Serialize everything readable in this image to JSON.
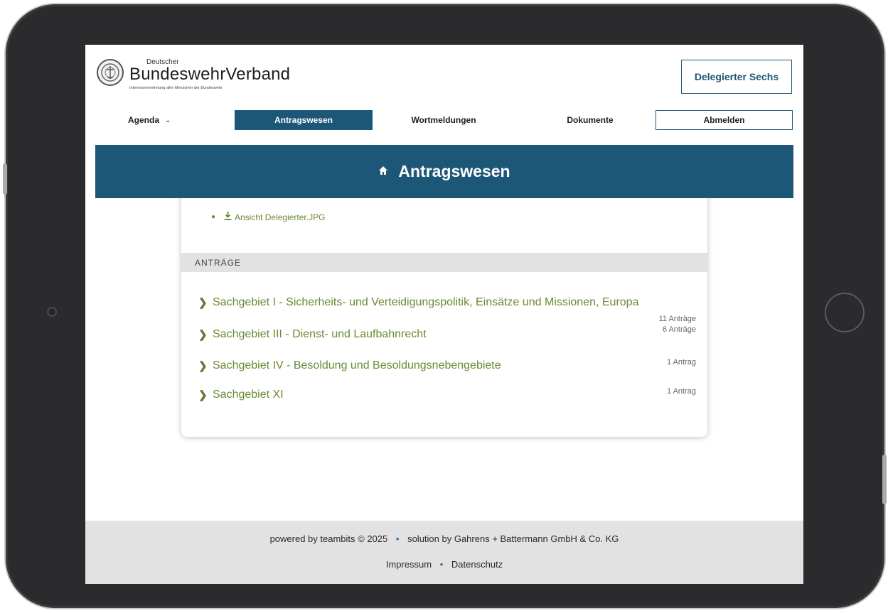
{
  "header": {
    "logo_small": "Deutscher",
    "logo_main": "BundeswehrVerband",
    "logo_tagline": "Interessenvertretung aller Menschen der Bundeswehr",
    "user_label": "Delegierter Sechs"
  },
  "nav": {
    "agenda": "Agenda",
    "antragswesen": "Antragswesen",
    "wortmeldungen": "Wortmeldungen",
    "dokumente": "Dokumente",
    "abmelden": "Abmelden"
  },
  "banner": {
    "title": "Antragswesen",
    "icon": "home-icon"
  },
  "attachment": {
    "label": "Ansicht Delegierter.JPG",
    "icon": "download-icon"
  },
  "section": {
    "title": "ANTRÄGE"
  },
  "antraege": [
    {
      "label": "Sachgebiet I - Sicherheits- und Verteidigungspolitik, Einsätze und Missionen, Europa",
      "count": "11 Anträge"
    },
    {
      "label": "Sachgebiet III - Dienst- und Laufbahnrecht",
      "count": "6 Anträge"
    },
    {
      "label": "Sachgebiet IV - Besoldung und Besoldungsnebengebiete",
      "count": "1 Antrag"
    },
    {
      "label": "Sachgebiet XI",
      "count": "1 Antrag"
    }
  ],
  "footer": {
    "powered": "powered by teambits © 2025",
    "solution": "solution by Gahrens + Battermann GmbH & Co. KG",
    "impressum": "Impressum",
    "datenschutz": "Datenschutz"
  },
  "colors": {
    "primary": "#1c5777",
    "link_green": "#6b8a34",
    "footer_bg": "#e2e2e2"
  }
}
